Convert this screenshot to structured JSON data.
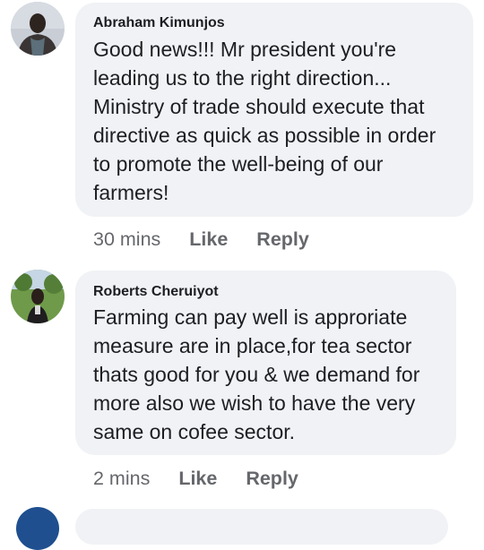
{
  "comments": [
    {
      "author": "Abraham Kimunjos",
      "lines": [
        "Good news!!! Mr president you're",
        "leading us to the right direction...",
        "Ministry of trade should execute that",
        "directive as quick as possible in order",
        "to promote the well-being of our",
        "farmers!"
      ],
      "time": "30 mins",
      "like_label": "Like",
      "reply_label": "Reply"
    },
    {
      "author": "Roberts Cheruiyot",
      "lines": [
        "Farming can pay well is approriate",
        "measure are in place,for tea sector",
        "thats good for you & we demand for",
        "more also we wish to have the very",
        "same on cofee sector."
      ],
      "time": "2 mins",
      "like_label": "Like",
      "reply_label": "Reply"
    }
  ],
  "colors": {
    "bubble_bg": "#f0f2f5",
    "meta_text": "#65676b",
    "body_text": "#1c1e21"
  }
}
